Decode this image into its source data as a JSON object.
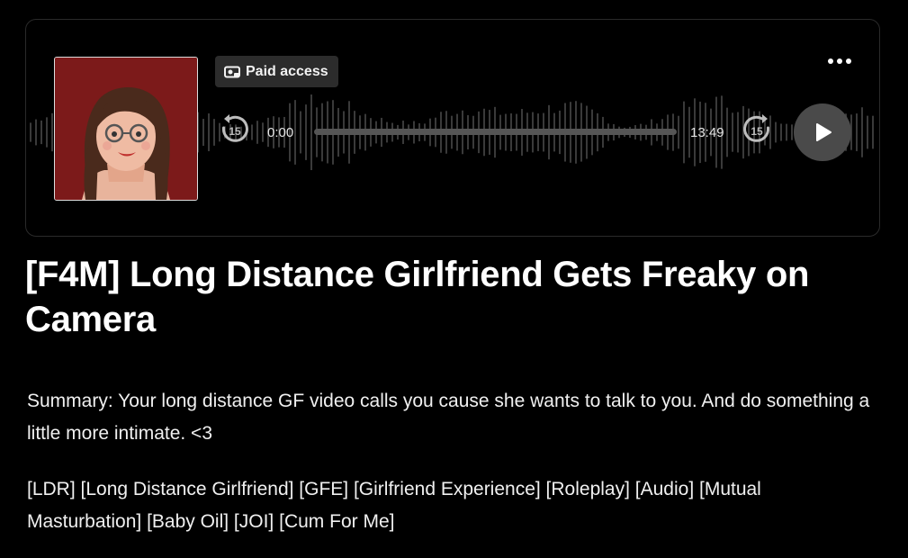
{
  "player": {
    "badge_label": "Paid access",
    "current_time": "0:00",
    "total_time": "13:49",
    "skip_back_seconds": "15",
    "skip_forward_seconds": "15",
    "progress": 0,
    "icons": {
      "badge": "paid-access-icon",
      "more": "more-options-icon",
      "skip_back": "skip-back-15-icon",
      "skip_forward": "skip-forward-15-icon",
      "play": "play-icon"
    }
  },
  "post": {
    "title": "[F4M] Long Distance Girlfriend Gets Freaky on Camera",
    "summary": "Summary: Your long distance GF video calls you cause she wants to talk to you. And do something a little more intimate. <3",
    "tags": "[LDR] [Long Distance Girlfriend] [GFE] [Girlfriend Experience] [Roleplay] [Audio] [Mutual Masturbation] [Baby Oil] [JOI] [Cum For Me]"
  },
  "colors": {
    "background": "#000000",
    "cover_background": "#7c1a1a",
    "badge_background": "#2c2c2c",
    "play_button": "#4a4a4a",
    "waveform": "#3a3a3a"
  }
}
